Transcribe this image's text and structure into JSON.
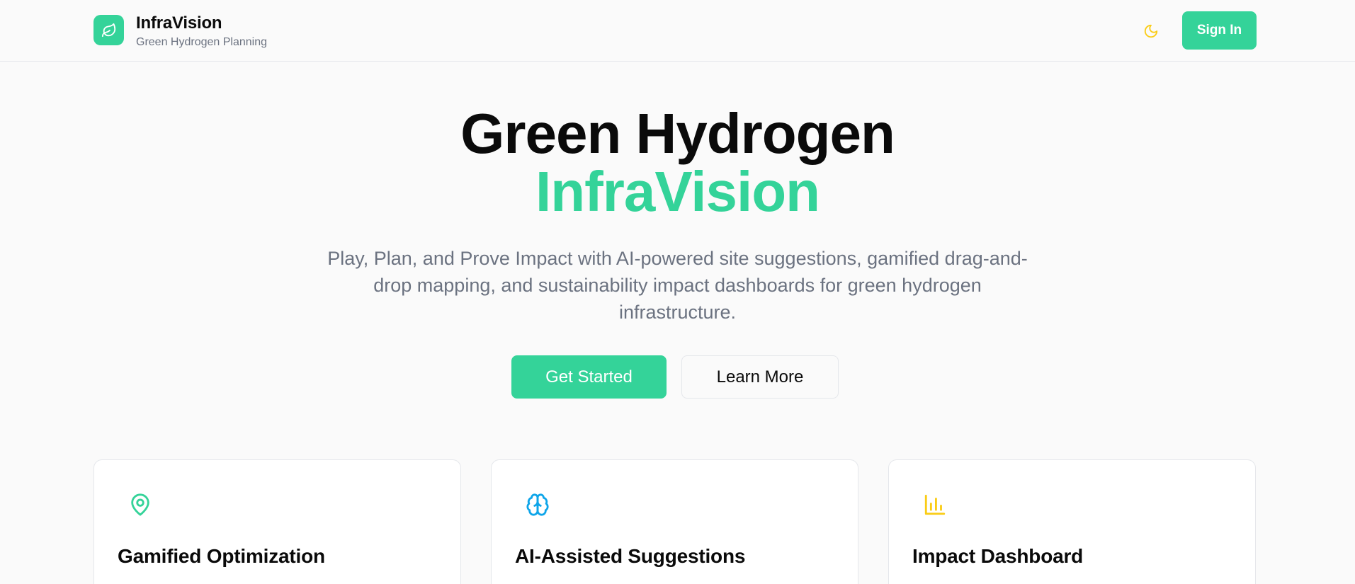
{
  "header": {
    "brand_title": "InfraVision",
    "brand_subtitle": "Green Hydrogen Planning",
    "logo_icon": "leaf-icon",
    "theme_toggle_icon": "moon-icon",
    "signin_label": "Sign In"
  },
  "hero": {
    "title_line1": "Green Hydrogen",
    "title_line2": "InfraVision",
    "description": "Play, Plan, and Prove Impact with AI-powered site suggestions, gamified drag-and-drop mapping, and sustainability impact dashboards for green hydrogen infrastructure.",
    "primary_cta": "Get Started",
    "secondary_cta": "Learn More"
  },
  "features": [
    {
      "title": "Gamified Optimization",
      "icon": "map-pin-icon",
      "icon_color": "#34d399"
    },
    {
      "title": "AI-Assisted Suggestions",
      "icon": "brain-icon",
      "icon_color": "#0ea5e9"
    },
    {
      "title": "Impact Dashboard",
      "icon": "bar-chart-icon",
      "icon_color": "#facc15"
    }
  ],
  "colors": {
    "accent": "#34d399",
    "background": "#fafafa",
    "muted_text": "#6b7280",
    "moon": "#facc15"
  }
}
